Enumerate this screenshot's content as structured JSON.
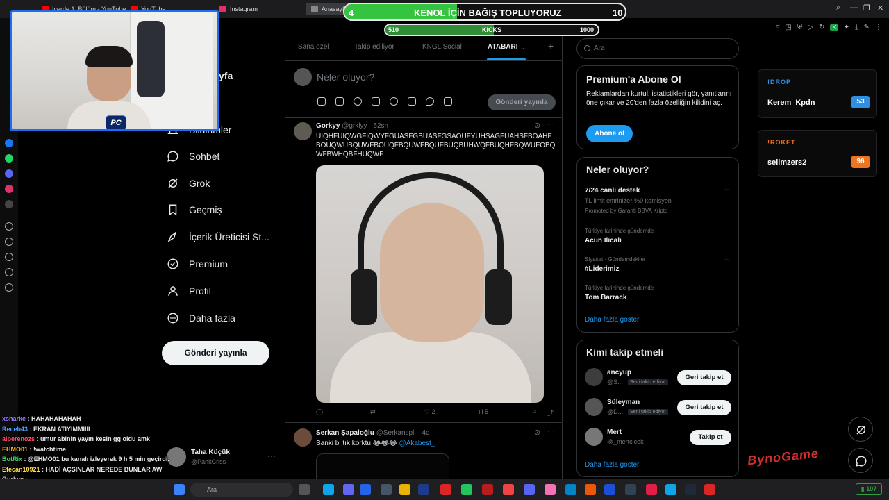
{
  "browser": {
    "tabs": [
      {
        "label": "İçerde 1. Bölüm - YouTube",
        "fav": "#ff0000"
      },
      {
        "label": "YouTube",
        "fav": "#ff0000"
      },
      {
        "label": "Instagram",
        "fav": "#e1306c"
      },
      {
        "label": "Anasayfa",
        "fav": "#888888"
      }
    ]
  },
  "donation": {
    "title": "KENOL İÇİN BAĞIŞ TOPLUYORUZ",
    "current": "4",
    "goal": "10",
    "progress": 0.4,
    "color": "#34c43f"
  },
  "kicks": {
    "label": "KICKS",
    "current": "510",
    "goal": "1000",
    "progress": 0.51
  },
  "sidebar": {
    "partial_label": "yfa",
    "items": [
      {
        "label": "Bildirimler",
        "icon": "bell-icon"
      },
      {
        "label": "Sohbet",
        "icon": "chat-icon"
      },
      {
        "label": "Grok",
        "icon": "grok-icon"
      },
      {
        "label": "Geçmiş",
        "icon": "bookmark-icon"
      },
      {
        "label": "İçerik Üreticisi St...",
        "icon": "rocket-icon"
      },
      {
        "label": "Premium",
        "icon": "verified-icon"
      },
      {
        "label": "Profil",
        "icon": "person-icon"
      },
      {
        "label": "Daha fazla",
        "icon": "more-circle-icon"
      }
    ],
    "post_button": "Gönderi yayınla",
    "profile": {
      "name": "Taha Küçük",
      "handle": "@PankCriss",
      "more": "···"
    }
  },
  "feed": {
    "tabs": [
      "Sana özel",
      "Takip ediliyor",
      "KNGL Social",
      "ATABARI"
    ],
    "active_tab": "ATABARI",
    "add_tab": "+",
    "compose_placeholder": "Neler oluyor?",
    "compose_post": "Gönderi yayınla",
    "tweets": [
      {
        "name": "Gorkyy",
        "handle": "@grklyy",
        "time": "52sn",
        "text": "UIQHFUIQWGFIQWYFGUASFGBUASFGSAOUFYUHSAGFUAHSFBOAHFBOUQWUBQUWFBOUQFBQUWFBQUFBUQBUHWQFBUQHFBQWUFOBQWFBWHQBFHUQWF",
        "likes": "2",
        "views": "5"
      },
      {
        "name": "Serkan Şapaloğlu",
        "handle": "@Serkanspll",
        "time": "4d",
        "text": "Sanki bi tık korktu 😂😂😂",
        "mention": "@Akabest_"
      }
    ]
  },
  "right": {
    "search_placeholder": "Ara",
    "premium": {
      "title": "Premium'a Abone Ol",
      "text": "Reklamlardan kurtul, istatistikleri gör, yanıtlarını öne çıkar ve 20'den fazla özelliğin kilidini aç.",
      "button": "Abone ol"
    },
    "trends": {
      "title": "Neler oluyor?",
      "promoted": {
        "title": "7/24 canlı destek",
        "sub": "TL limit emrinize* %0 komisyon",
        "promo": "Promoted by Garanti BBVA Kripto"
      },
      "items": [
        {
          "ctx": "Türkiye tarihinde gündemde",
          "title": "Acun Ilıcalı"
        },
        {
          "ctx": "Siyaset · Gündemdekiler",
          "title": "#Liderimiz"
        },
        {
          "ctx": "Türkiye tarihinde gündemde",
          "title": "Tom Barrack"
        }
      ],
      "more": "Daha fazla göster"
    },
    "who_to_follow": {
      "title": "Kimi takip etmeli",
      "users": [
        {
          "name": "ancyup",
          "handle": "@S...",
          "tag": "Seni takip ediyor",
          "button": "Geri takip et"
        },
        {
          "name": "Süleyman",
          "handle": "@D...",
          "tag": "Seni takip ediyor",
          "button": "Geri takip et"
        },
        {
          "name": "Mert",
          "handle": "@_mertcicek",
          "tag": "",
          "button": "Takip et"
        }
      ],
      "more": "Daha fazla göster"
    }
  },
  "overlays": {
    "drop": {
      "title": "!DROP",
      "name": "Kerem_Kpdn",
      "value": "53",
      "color": "#2f8fe0"
    },
    "roket": {
      "title": "!ROKET",
      "name": "selimzers2",
      "value": "96",
      "color": "#f0731f"
    },
    "brand": "BynoGame"
  },
  "chat": [
    {
      "user": "xsharke",
      "msg": "HAHAHAHAHAH",
      "color": "#9b7cff"
    },
    {
      "user": "Receb43",
      "msg": "EKRAN ATIYIMMIIII",
      "color": "#4aa3ff"
    },
    {
      "user": "alperenozs",
      "msg": "umur abinin yayın kesin gg oldu amk",
      "color": "#ff4d6d"
    },
    {
      "user": "EHMO01",
      "msg": "!watchtime",
      "color": "#ffb020"
    },
    {
      "user": "BotRix",
      "msg": "@EHMO01 bu kanalı izleyerek 9 h 5 min geçirdi.",
      "color": "#3fd16b"
    },
    {
      "user": "Efecan10921",
      "msg": "HADİ AÇSINLAR NEREDE BUNLAR AW",
      "color": "#ffe14d"
    },
    {
      "user": "Gorkyy",
      "msg": "",
      "color": "#cfcfcf"
    }
  ],
  "taskbar": {
    "search": "Ara",
    "tray_value": "107"
  }
}
